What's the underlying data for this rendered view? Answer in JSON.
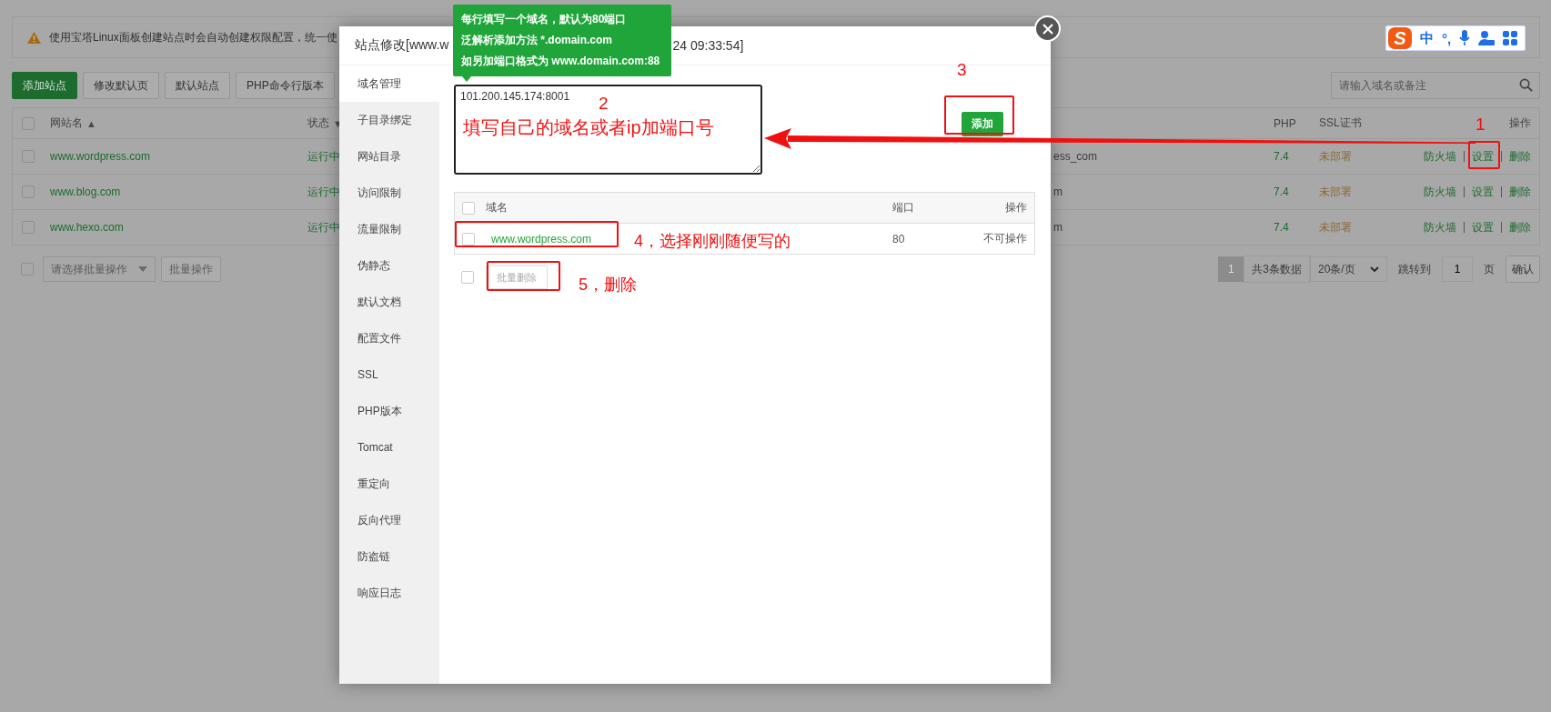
{
  "notice": {
    "text": "使用宝塔Linux面板创建站点时会自动创建权限配置，统一使"
  },
  "ime_toolbar": {
    "logo": "S",
    "items": [
      "中",
      "°,"
    ]
  },
  "toolbar": {
    "buttons": [
      {
        "label": "添加站点",
        "kind": "primary"
      },
      {
        "label": "修改默认页",
        "kind": "default"
      },
      {
        "label": "默认站点",
        "kind": "default"
      },
      {
        "label": "PHP命令行版本",
        "kind": "default"
      }
    ]
  },
  "search": {
    "placeholder": "请输入域名或备注"
  },
  "sites_table": {
    "header_checked": false,
    "columns": [
      {
        "label": "网站名",
        "sort_mark": "▲"
      },
      {
        "label": "状态",
        "sort_mark": "▼"
      },
      {
        "label": "PHP"
      },
      {
        "label": "SSL证书"
      },
      {
        "label": "操作"
      }
    ],
    "rows": [
      {
        "checked": false,
        "name": "www.wordpress.com",
        "status": "运行中",
        "column_3": "ess_com",
        "php": "7.4",
        "ssl": "未部署",
        "actions": [
          "防火墙",
          "设置",
          "删除"
        ]
      },
      {
        "checked": false,
        "name": "www.blog.com",
        "status": "运行中",
        "column_3": "m",
        "php": "7.4",
        "ssl": "未部署",
        "actions": [
          "防火墙",
          "设置",
          "删除"
        ]
      },
      {
        "checked": false,
        "name": "www.hexo.com",
        "status": "运行中",
        "column_3": "m",
        "php": "7.4",
        "ssl": "未部署",
        "actions": [
          "防火墙",
          "设置",
          "删除"
        ]
      }
    ]
  },
  "batch": {
    "checked": false,
    "placeholder": "请选择批量操作",
    "button": "批量操作"
  },
  "pagination": {
    "pages": [
      {
        "label": "1",
        "selected": true
      }
    ],
    "total": "共3条数据",
    "page_size": "20条/页",
    "jump_label": "跳转到",
    "jump_value": "1",
    "page_unit": "页",
    "confirm": "确认"
  },
  "modal": {
    "title_start": "站点修改[www.w",
    "title_end": "24 09:33:54]",
    "tabs": [
      {
        "label": "域名管理",
        "selected": true
      },
      {
        "label": "子目录绑定",
        "selected": false
      },
      {
        "label": "网站目录",
        "selected": false
      },
      {
        "label": "访问限制",
        "selected": false
      },
      {
        "label": "流量限制",
        "selected": false
      },
      {
        "label": "伪静态",
        "selected": false
      },
      {
        "label": "默认文档",
        "selected": false
      },
      {
        "label": "配置文件",
        "selected": false
      },
      {
        "label": "SSL",
        "selected": false
      },
      {
        "label": "PHP版本",
        "selected": false
      },
      {
        "label": "Tomcat",
        "selected": false
      },
      {
        "label": "重定向",
        "selected": false
      },
      {
        "label": "反向代理",
        "selected": false
      },
      {
        "label": "防盗链",
        "selected": false
      },
      {
        "label": "响应日志",
        "selected": false
      }
    ],
    "tooltip": [
      "每行填写一个域名，默认为80端口",
      "泛解析添加方法 *.domain.com",
      "如另加端口格式为 www.domain.com:88"
    ],
    "domain_input": {
      "value": "101.200.145.174:8001"
    },
    "add_button": "添加",
    "domain_table": {
      "columns": [
        "域名",
        "端口",
        "操作"
      ],
      "header_checked": false,
      "rows": [
        {
          "checked": false,
          "domain": "www.wordpress.com",
          "port": "80",
          "action": "不可操作"
        }
      ]
    },
    "batch_checked": false,
    "batch_delete": {
      "label": "批量删除",
      "disabled": true
    }
  },
  "annotations": [
    {
      "kind": "number",
      "text": "3"
    },
    {
      "kind": "box"
    },
    {
      "kind": "number",
      "text": "2"
    },
    {
      "kind": "note",
      "text": "填写自己的域名或者ip加端口号"
    },
    {
      "kind": "arrow"
    },
    {
      "kind": "number",
      "text": "1"
    },
    {
      "kind": "box"
    },
    {
      "kind": "box"
    },
    {
      "kind": "note",
      "text": "4，选择刚刚随便写的"
    },
    {
      "kind": "box"
    },
    {
      "kind": "note",
      "text": "5，删除"
    }
  ]
}
